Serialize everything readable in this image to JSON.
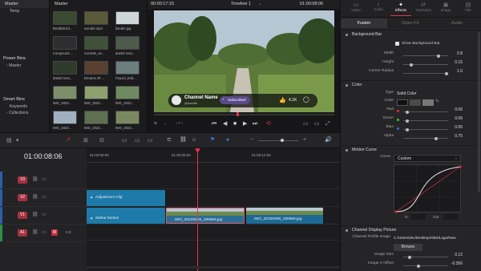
{
  "bins": {
    "master_title": "Master",
    "master_items": [
      "Temp"
    ],
    "power_bins_title": "Power Bins",
    "power_bins_items": [
      "Master"
    ],
    "smart_bins_title": "Smart Bins",
    "smart_bins_items": [
      "Keywords",
      "Collections"
    ]
  },
  "media": {
    "title": "Master",
    "items": [
      {
        "label": "BS3658.hd...",
        "color": "#3a4a30"
      },
      {
        "label": "wonder.mp4",
        "color": "#5a5a3a"
      },
      {
        "label": "Ilander.jpg",
        "color": "#cfd6d8"
      },
      {
        "label": "Compound ...",
        "color": "#2e2e30"
      },
      {
        "label": "Corrette_se...",
        "color": "#40513a"
      },
      {
        "label": "dastrd reso...",
        "color": "#4e5a4a"
      },
      {
        "label": "dastrd reso...",
        "color": "#2e3a2a"
      },
      {
        "label": "Dreams Of ...",
        "color": "#5a4030"
      },
      {
        "label": "Faucet_brid...",
        "color": "#6a7f7e"
      },
      {
        "label": "IMG_2023...",
        "color": "#7d8f6a"
      },
      {
        "label": "IMG_2023...",
        "color": "#8da06e"
      },
      {
        "label": "IMG_2023...",
        "color": "#6f8a60"
      },
      {
        "label": "IMG_2023...",
        "color": "#a0b0c0"
      },
      {
        "label": "IMG_2023...",
        "color": "#5f7050"
      },
      {
        "label": "IMG_2023...",
        "color": "#7a8860"
      }
    ]
  },
  "viewer": {
    "timecode_left": "00:00:17:15",
    "timeline_name": "Timeline 1",
    "timecode_right": "01:00:08:06",
    "channel_name": "Channel Name",
    "channel_handle": "@handle",
    "subscribed": "Subscribed",
    "likes": "4.1K"
  },
  "inspector": {
    "top_tabs": [
      "Video",
      "Audio",
      "Effects",
      "Transition",
      "Image",
      "File"
    ],
    "active_top_tab": "Effects",
    "sub_tabs": [
      "Fusion",
      "Open FX",
      "Audio"
    ],
    "section_background": "Background Bar",
    "show_background_label": "Show Background Bar",
    "width_label": "Width",
    "width_value": "0.8",
    "width_level": 0.8,
    "height_label": "Height",
    "height_value": "0.15",
    "height_level": 0.15,
    "corner_label": "Corner Radius",
    "corner_value": "1.0",
    "corner_level": 1.0,
    "section_color": "Color",
    "type_label": "Type",
    "type_value": "Solid Color",
    "color_label": "Color",
    "red_label": "Red",
    "red_value": "0.06",
    "red_level": 0.06,
    "green_label": "Green",
    "green_value": "0.06",
    "green_level": 0.06,
    "blue_label": "Blue",
    "blue_value": "0.06",
    "blue_level": 0.06,
    "alpha_label": "Alpha",
    "alpha_value": "0.75",
    "alpha_level": 0.75,
    "section_motion": "Motion Curve",
    "curve_label": "Curve",
    "curve_value": "Custom",
    "in_label": "In",
    "out_label": "Out",
    "section_channel": "Channel Display Picture",
    "profile_label": "Channel Profile Image",
    "profile_path": "C:/Users/dev/Desktop/OBS/Logo/New",
    "browse_label": "Browse",
    "image_size_label": "Image Size",
    "image_size_value": "0.12",
    "image_size_level": 0.12,
    "image_x_label": "Image X Offset",
    "image_x_value": "-0.356",
    "image_x_level": 0.32
  },
  "timeline": {
    "timecode": "01:00:08:06",
    "ruler": [
      "01:00:00:00",
      "01:00:06:00",
      "01:00:12:00"
    ],
    "tracks": [
      {
        "id": "V3",
        "type": "video"
      },
      {
        "id": "V2",
        "type": "video"
      },
      {
        "id": "V1",
        "type": "video"
      },
      {
        "id": "A1",
        "type": "audio",
        "level": "2.0"
      }
    ],
    "clips": {
      "adjustment": "Adjustment Clip",
      "stellar": "Stellar Motion",
      "img1": "IMG_20220608_195556.jpg",
      "img2": "IMG_20220608_195556.jpg"
    }
  },
  "colors": {
    "accent": "#e0334a",
    "clip_blue": "#1e7aa8",
    "clip_selected": "#e05a6a"
  }
}
